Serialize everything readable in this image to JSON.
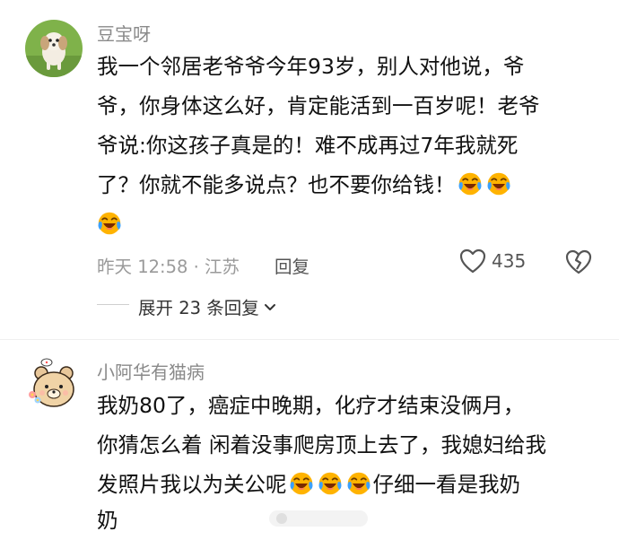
{
  "comments": [
    {
      "username": "豆宝呀",
      "avatar_icon": "dog-photo-avatar",
      "lines": [
        "我一个邻居老爷爷今年93岁，别人对他说，爷",
        "爷，你身体这么好，肯定能活到一百岁呢！老爷",
        "爷说:你这孩子真是的！难不成再过7年我就死",
        "了？你就不能多说点？也不要你给钱！",
        ""
      ],
      "time_location": "昨天 12:58 · 江苏",
      "reply_label": "回复",
      "like_count": "435",
      "expand_label": "展开 23 条回复"
    },
    {
      "username": "小阿华有猫病",
      "avatar_icon": "cartoon-bear-avatar",
      "lines": [
        "我奶80了，癌症中晚期，化疗才结束没俩月，",
        "你猜怎么着 闲着没事爬房顶上去了，我媳妇给我",
        "发照片我以为关公呢",
        "仔细一看是我奶",
        "奶"
      ]
    }
  ],
  "icons": {
    "emoji": "laughing-crying-emoji",
    "like": "heart-outline-icon",
    "dislike": "broken-heart-icon",
    "chevron": "chevron-down-icon"
  },
  "colors": {
    "username": "#8a8a8a",
    "meta": "#9a9a9a",
    "emoji_face": "#ffb300",
    "emoji_tear": "#3aa0ff"
  }
}
